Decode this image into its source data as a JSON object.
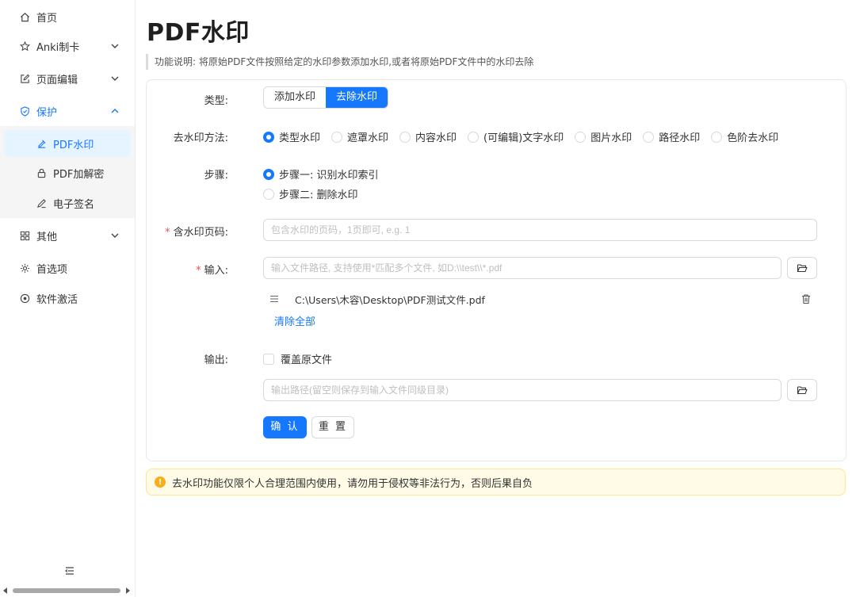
{
  "sidebar": {
    "items": [
      {
        "label": "首页",
        "icon": "home-icon"
      },
      {
        "label": "Anki制卡",
        "icon": "star-icon"
      },
      {
        "label": "页面编辑",
        "icon": "edit-icon"
      },
      {
        "label": "保护",
        "icon": "shield-icon"
      },
      {
        "label": "其他",
        "icon": "grid-icon"
      },
      {
        "label": "首选项",
        "icon": "gear-icon"
      },
      {
        "label": "软件激活",
        "icon": "target-icon"
      }
    ],
    "protect_sub": [
      {
        "label": "PDF水印",
        "icon": "stamp-icon"
      },
      {
        "label": "PDF加解密",
        "icon": "lock-icon"
      },
      {
        "label": "电子签名",
        "icon": "pen-icon"
      }
    ]
  },
  "page": {
    "title": "PDF水印",
    "description": "功能说明: 将原始PDF文件按照给定的水印参数添加水印,或者将原始PDF文件中的水印去除"
  },
  "form": {
    "type_label": "类型:",
    "type_options": [
      "添加水印",
      "去除水印"
    ],
    "type_selected": "去除水印",
    "method_label": "去水印方法:",
    "method_options": [
      "类型水印",
      "遮罩水印",
      "内容水印",
      "(可编辑)文字水印",
      "图片水印",
      "路径水印",
      "色阶去水印"
    ],
    "method_selected": "类型水印",
    "step_label": "步骤:",
    "step_options": [
      "步骤一: 识别水印索引",
      "步骤二: 删除水印"
    ],
    "step_selected": "步骤一: 识别水印索引",
    "pages_label": "含水印页码:",
    "pages_placeholder": "包含水印的页码，1页即可, e.g. 1",
    "input_label": "输入:",
    "input_placeholder": "输入文件路径, 支持使用*匹配多个文件, 如D:\\\\test\\\\*.pdf",
    "file_path": "C:\\Users\\木容\\Desktop\\PDF测试文件.pdf",
    "clear_all": "清除全部",
    "output_label": "输出:",
    "overwrite_label": "覆盖原文件",
    "output_placeholder": "输出路径(留空则保存到输入文件同级目录)",
    "confirm": "确 认",
    "reset": "重 置"
  },
  "alert": {
    "text": "去水印功能仅限个人合理范围内使用，请勿用于侵权等非法行为，否则后果自负"
  },
  "colors": {
    "accent": "#1677ff",
    "warning": "#faad14",
    "required": "#ff4d4f"
  }
}
